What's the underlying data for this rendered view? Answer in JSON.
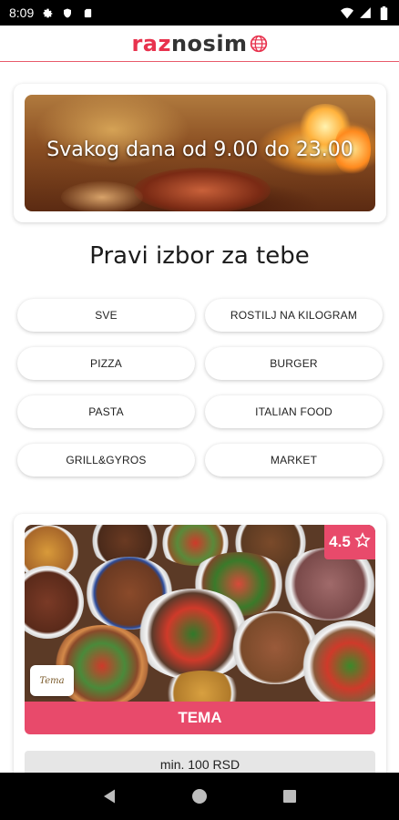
{
  "status_bar": {
    "time": "8:09",
    "icons_left": [
      "gear-icon",
      "shield-icon",
      "sd-card-icon"
    ],
    "icons_right": [
      "wifi-icon",
      "signal-icon",
      "battery-icon"
    ]
  },
  "header": {
    "logo_part1": "raz",
    "logo_part2": "nosim",
    "logo_icon": "globe-icon",
    "brand_color": "#e8334e",
    "divider_color": "#e85a6a"
  },
  "hero": {
    "text": "Svakog dana od 9.00 do 23.00"
  },
  "categories": {
    "title": "Pravi izbor za tebe",
    "items": [
      {
        "label": "SVE"
      },
      {
        "label": "ROSTILJ NA KILOGRAM"
      },
      {
        "label": "PIZZA"
      },
      {
        "label": "BURGER"
      },
      {
        "label": "PASTA"
      },
      {
        "label": "ITALIAN FOOD"
      },
      {
        "label": "GRILL&GYROS"
      },
      {
        "label": "MARKET"
      }
    ]
  },
  "restaurant": {
    "rating": "4.5",
    "rating_icon": "star-outline-icon",
    "logo_text": "Tema",
    "name": "TEMA",
    "min_order": "min. 100 RSD",
    "accent_color": "#e84a6b"
  },
  "nav": {
    "buttons": [
      "back-icon",
      "home-icon",
      "recents-icon"
    ]
  }
}
